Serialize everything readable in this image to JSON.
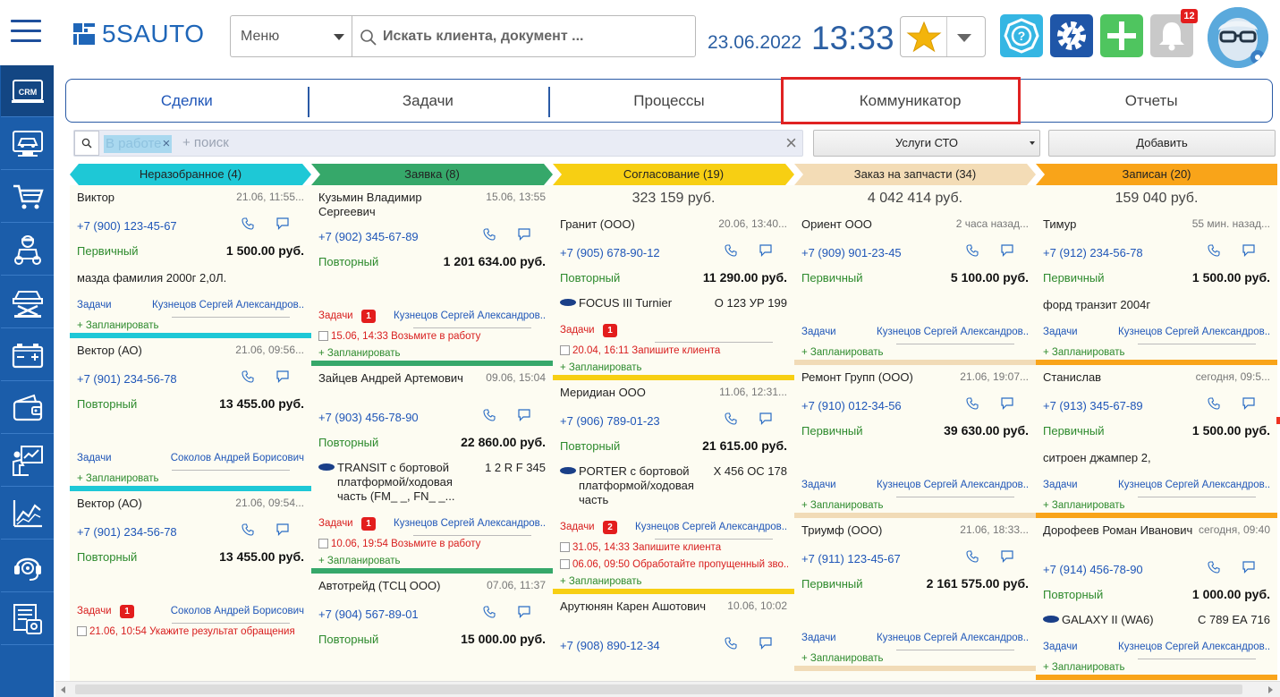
{
  "header": {
    "logo_text": "5SAUTO",
    "menu_label": "Меню",
    "search_placeholder": "Искать клиента, документ ...",
    "date": "23.06.2022",
    "time": "13:33",
    "notifications_count": "12"
  },
  "colors": {
    "brand_blue": "#1b5daa",
    "accent_blue": "#1f56b8",
    "highlight_red": "#e02222"
  },
  "sidebar": {
    "items": [
      {
        "icon": "crm-icon",
        "label": "CRM",
        "active": true
      },
      {
        "icon": "car-diagnostics-icon"
      },
      {
        "icon": "shopping-cart-icon"
      },
      {
        "icon": "mechanic-icon"
      },
      {
        "icon": "car-lift-icon"
      },
      {
        "icon": "battery-icon"
      },
      {
        "icon": "wallet-icon"
      },
      {
        "icon": "presentation-icon"
      },
      {
        "icon": "analytics-chart-icon"
      },
      {
        "icon": "support-headset-icon"
      },
      {
        "icon": "reports-icon"
      }
    ]
  },
  "tabs": [
    {
      "label": "Сделки",
      "active": true
    },
    {
      "label": "Задачи"
    },
    {
      "label": "Процессы"
    },
    {
      "label": "Коммуникатор",
      "highlighted": true
    },
    {
      "label": "Отчеты"
    }
  ],
  "filter": {
    "chip": "В работе",
    "placeholder": "+ поиск",
    "service_select": "Услуги СТО",
    "add_button": "Добавить"
  },
  "labels": {
    "tasks": "Задачи",
    "plan": "+ Запланировать"
  },
  "columns": [
    {
      "title": "Неразобранное (4)",
      "color": "#1ec8d6",
      "bar": "#1ec8d6",
      "sum": "",
      "cards": [
        {
          "name": "Виктор",
          "time": "21.06, 11:55...",
          "phone": "+7 (900) 123-45-67",
          "status": "Первичный",
          "amount": "1 500.00 руб.",
          "note": "мазда фамилия 2000г 2,0Л.",
          "manager": "Кузнецов Сергей Александров...",
          "badge": "",
          "todos": []
        },
        {
          "name": "Вектор (АО)",
          "time": "21.06, 09:56...",
          "phone": "+7 (901) 234-56-78",
          "status": "Повторный",
          "amount": "13 455.00 руб.",
          "manager": "Соколов Андрей Борисович",
          "badge": "",
          "todos": []
        },
        {
          "name": "Вектор (АО)",
          "time": "21.06, 09:54...",
          "phone": "+7 (901) 234-56-78",
          "status": "Повторный",
          "amount": "13 455.00 руб.",
          "manager": "Соколов Андрей Борисович",
          "badge": "1",
          "todos": [
            "21.06, 10:54 Укажите результат обращения"
          ]
        }
      ]
    },
    {
      "title": "Заявка (8)",
      "color": "#36a86a",
      "bar": "#36a86a",
      "sum": "",
      "cards": [
        {
          "name": "Кузьмин Владимир Сергеевич",
          "time": "15.06, 13:55",
          "phone": "+7 (902) 345-67-89",
          "status": "Повторный",
          "amount": "1 201 634.00 руб.",
          "manager": "Кузнецов Сергей Александров...",
          "badge": "1",
          "todos": [
            "15.06, 14:33 Возьмите в работу"
          ]
        },
        {
          "name": "Зайцев Андрей Артемович",
          "time": "09.06, 15:04",
          "phone": "+7 (903) 456-78-90",
          "status": "Повторный",
          "amount": "22 860.00 руб.",
          "car": "TRANSIT с бортовой платформой/ходовая часть (FM_ _, FN_ _...",
          "plate": "1 2 R F  345",
          "manager": "Кузнецов Сергей Александров...",
          "badge": "1",
          "todos": [
            "10.06, 19:54 Возьмите в работу"
          ]
        },
        {
          "name": "Автотрейд (ТСЦ ООО)",
          "time": "07.06, 11:37",
          "phone": "+7 (904) 567-89-01",
          "status": "Повторный",
          "amount": "15 000.00 руб.",
          "manager": "",
          "badge": "",
          "todos": []
        }
      ]
    },
    {
      "title": "Согласование (19)",
      "color": "#f7cf13",
      "bar": "#f7cf13",
      "sum": "323 159 руб.",
      "cards": [
        {
          "name": "Гранит (ООО)",
          "time": "20.06, 13:40...",
          "phone": "+7 (905) 678-90-12",
          "status": "Повторный",
          "amount": "11 290.00 руб.",
          "car": "FOCUS III Turnier",
          "plate": "О 123 УР 199",
          "manager": "",
          "badge": "1",
          "todos": [
            "20.04, 16:11 Запишите клиента"
          ]
        },
        {
          "name": "Меридиан ООО",
          "time": "11.06, 12:31...",
          "phone": "+7 (906) 789-01-23",
          "status": "Повторный",
          "amount": "21 615.00 руб.",
          "car": "PORTER с бортовой платформой/ходовая часть",
          "plate": "Х 456 ОС 178",
          "manager": "Кузнецов Сергей Александров...",
          "badge": "2",
          "todos": [
            "31.05, 14:33 Запишите клиента",
            "06.06, 09:50 Обработайте пропущенный зво..."
          ]
        },
        {
          "name": "Арутюнян Карен Ашотович",
          "time": "10.06, 10:02",
          "phone": "+7 (908) 890-12-34",
          "status": "",
          "amount": "",
          "manager": "",
          "badge": "",
          "todos": []
        }
      ]
    },
    {
      "title": "Заказ на запчасти (34)",
      "color": "#f3dcb6",
      "bar": "#f1dbb7",
      "sum": "4 042 414 руб.",
      "cards": [
        {
          "name": "Ориент ООО",
          "time": "2 часа назад...",
          "phone": "+7 (909) 901-23-45",
          "status": "Первичный",
          "amount": "5 100.00 руб.",
          "manager": "Кузнецов Сергей Александров...",
          "badge": "",
          "todos": []
        },
        {
          "name": "Ремонт Групп (ООО)",
          "time": "21.06, 19:07...",
          "phone": "+7 (910) 012-34-56",
          "status": "Первичный",
          "amount": "39 630.00 руб.",
          "manager": "Кузнецов Сергей Александров...",
          "badge": "",
          "todos": []
        },
        {
          "name": "Триумф (ООО)",
          "time": "21.06, 18:33...",
          "phone": "+7 (911) 123-45-67",
          "status": "Первичный",
          "amount": "2 161 575.00 руб.",
          "manager": "Кузнецов Сергей Александров...",
          "badge": "",
          "todos": []
        }
      ]
    },
    {
      "title": "Записан (20)",
      "color": "#f9a419",
      "bar": "#f9a419",
      "sum": "159 040 руб.",
      "cards": [
        {
          "name": "Тимур",
          "time": "55 мин. назад...",
          "phone": "+7 (912) 234-56-78",
          "status": "Первичный",
          "amount": "1 500.00 руб.",
          "note": "форд транзит 2004г",
          "manager": "Кузнецов Сергей Александров...",
          "badge": "",
          "todos": []
        },
        {
          "name": "Станислав",
          "time": "сегодня, 09:5...",
          "phone": "+7 (913) 345-67-89",
          "status": "Первичный",
          "amount": "1 500.00 руб.",
          "note": "ситроен джампер 2,",
          "manager": "Кузнецов Сергей Александров...",
          "badge": "",
          "todos": []
        },
        {
          "name": "Дорофеев Роман Иванович",
          "time": "сегодня, 09:40",
          "phone": "+7 (914) 456-78-90",
          "status": "Повторный",
          "amount": "1 000.00 руб.",
          "car": "GALAXY II (WA6)",
          "plate": "С 789 ЕА 716",
          "manager": "Кузнецов Сергей Александров...",
          "badge": "",
          "todos": []
        }
      ]
    }
  ]
}
